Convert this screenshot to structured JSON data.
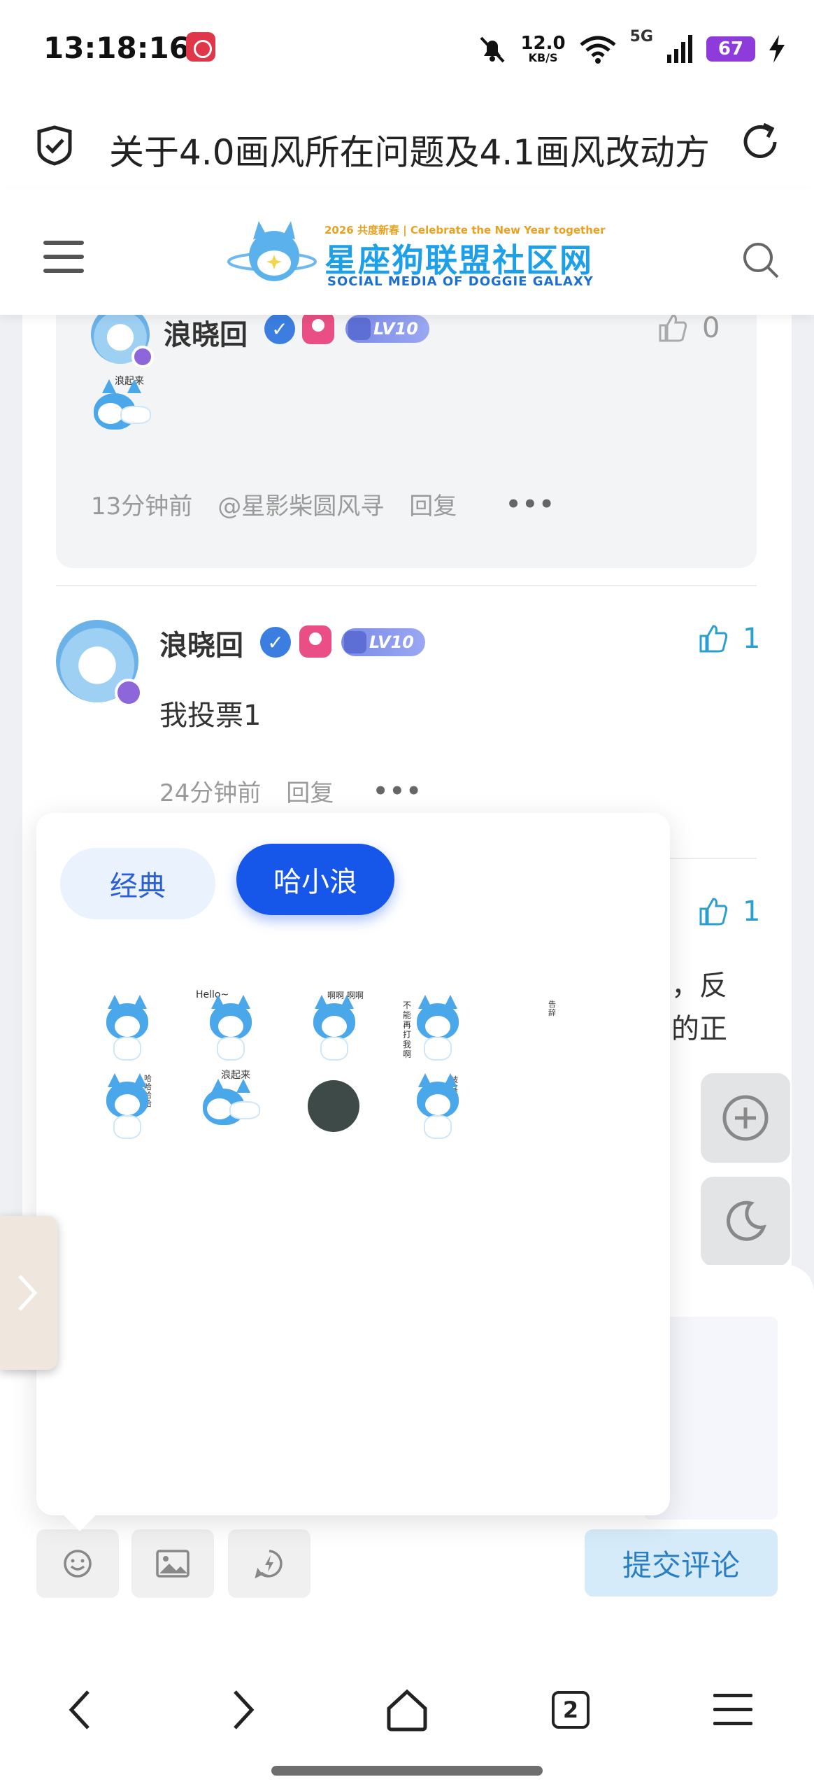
{
  "status_bar": {
    "time": "13:18:16",
    "net_speed_value": "12.0",
    "net_speed_unit": "KB/S",
    "network": "5G",
    "battery": "67",
    "icons": [
      "app-notification-icon",
      "mute-bell-icon",
      "wifi-icon",
      "signal-icon",
      "battery-icon",
      "charging-icon"
    ]
  },
  "browser": {
    "page_title": "关于4.0画风所在问题及4.1画风改动方",
    "tab_count": "2"
  },
  "site": {
    "logo_small": "2026 共度新春 | Celebrate the New Year together",
    "logo_main": "星座狗联盟社区网",
    "logo_sub": "SOCIAL MEDIA OF DOGGIE GALAXY",
    "accent_color": "#1656e8"
  },
  "reply": {
    "user": "浪晓回",
    "level": "LV10",
    "likes": "0",
    "sticker_caption": "浪起来",
    "time": "13分钟前",
    "mention": "@星影柴圆风寻",
    "reply_label": "回复",
    "more": "•••"
  },
  "comment": {
    "user": "浪晓回",
    "level": "LV10",
    "likes": "1",
    "text": "我投票1",
    "time": "24分钟前",
    "reply_label": "回复",
    "more": "•••"
  },
  "partial_comment": {
    "likes": "1",
    "line1": "，反",
    "line2": "的正"
  },
  "emoji_panel": {
    "tabs": [
      {
        "label": "经典",
        "active": false
      },
      {
        "label": "哈小浪",
        "active": true
      }
    ],
    "stickers": [
      {
        "name": "sticker-crying",
        "caption": ""
      },
      {
        "name": "sticker-hello",
        "caption": "Hello~"
      },
      {
        "name": "sticker-shouting",
        "caption": "啊啊 啊啊"
      },
      {
        "name": "sticker-refuse",
        "caption": "不能再打我啊"
      },
      {
        "name": "sticker-small-text",
        "caption": "告辞"
      },
      {
        "name": "sticker-laughing",
        "caption": "哈哈哈哈"
      },
      {
        "name": "sticker-lying",
        "caption": "浪起来"
      },
      {
        "name": "sticker-dark",
        "caption": ""
      },
      {
        "name": "sticker-poisoned",
        "caption": "被其中毒"
      }
    ]
  },
  "composer": {
    "submit_label": "提交评论",
    "tools": [
      "emoji-icon",
      "image-icon",
      "flash-icon"
    ]
  }
}
